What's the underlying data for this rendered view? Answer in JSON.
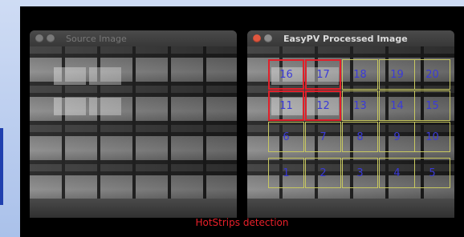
{
  "windows": {
    "source": {
      "title": "Source Image"
    },
    "processed": {
      "title": "EasyPV Processed Image"
    }
  },
  "panels": [
    {
      "label": "16",
      "status": "hotspot"
    },
    {
      "label": "17",
      "status": "hotspot"
    },
    {
      "label": "18",
      "status": "normal"
    },
    {
      "label": "19",
      "status": "normal"
    },
    {
      "label": "20",
      "status": "normal"
    },
    {
      "label": "11",
      "status": "hotspot"
    },
    {
      "label": "12",
      "status": "hotspot"
    },
    {
      "label": "13",
      "status": "normal"
    },
    {
      "label": "14",
      "status": "normal"
    },
    {
      "label": "15",
      "status": "normal"
    },
    {
      "label": "6",
      "status": "normal"
    },
    {
      "label": "7",
      "status": "normal"
    },
    {
      "label": "8",
      "status": "normal"
    },
    {
      "label": "9",
      "status": "normal"
    },
    {
      "label": "10",
      "status": "normal"
    },
    {
      "label": "1",
      "status": "normal"
    },
    {
      "label": "2",
      "status": "normal"
    },
    {
      "label": "3",
      "status": "normal"
    },
    {
      "label": "4",
      "status": "normal"
    },
    {
      "label": "5",
      "status": "normal"
    }
  ],
  "caption": "HotStrips detection",
  "colors": {
    "hotspot_border": "#e0202a",
    "panel_border": "#c8c860",
    "panel_label": "#3a3ad8",
    "caption": "#e8202a"
  }
}
